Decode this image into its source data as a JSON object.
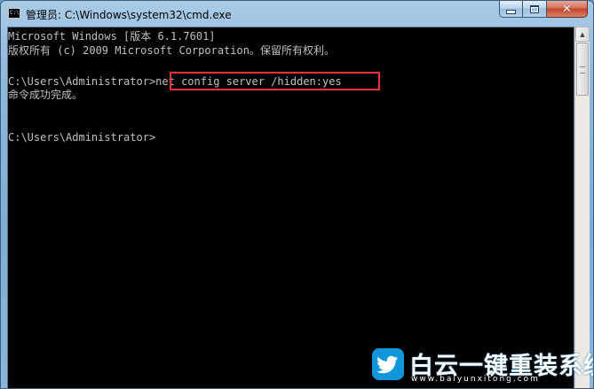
{
  "window": {
    "title": "管理员: C:\\Windows\\system32\\cmd.exe",
    "icon_label": "C:\\"
  },
  "caption_buttons": {
    "minimize": "minimize-icon",
    "maximize": "maximize-icon",
    "close": "close-icon",
    "close_glyph": "✕"
  },
  "console": {
    "lines": [
      "Microsoft Windows [版本 6.1.7601]",
      "版权所有 (c) 2009 Microsoft Corporation。保留所有权利。",
      "",
      "C:\\Users\\Administrator>net config server /hidden:yes",
      "命令成功完成。",
      "",
      "",
      "C:\\Users\\Administrator>"
    ],
    "highlighted_command": "net config server /hidden:yes",
    "highlight_color": "#e8353b",
    "text_color": "#c0c0c0",
    "background": "#000000"
  },
  "scrollbar": {
    "up_arrow": "▲",
    "down_arrow": "▼"
  },
  "watermark": {
    "brand": "白云一键重装系统",
    "url": "www.baiyunxitong.com",
    "logo_icon": "twitter-bird-icon"
  }
}
